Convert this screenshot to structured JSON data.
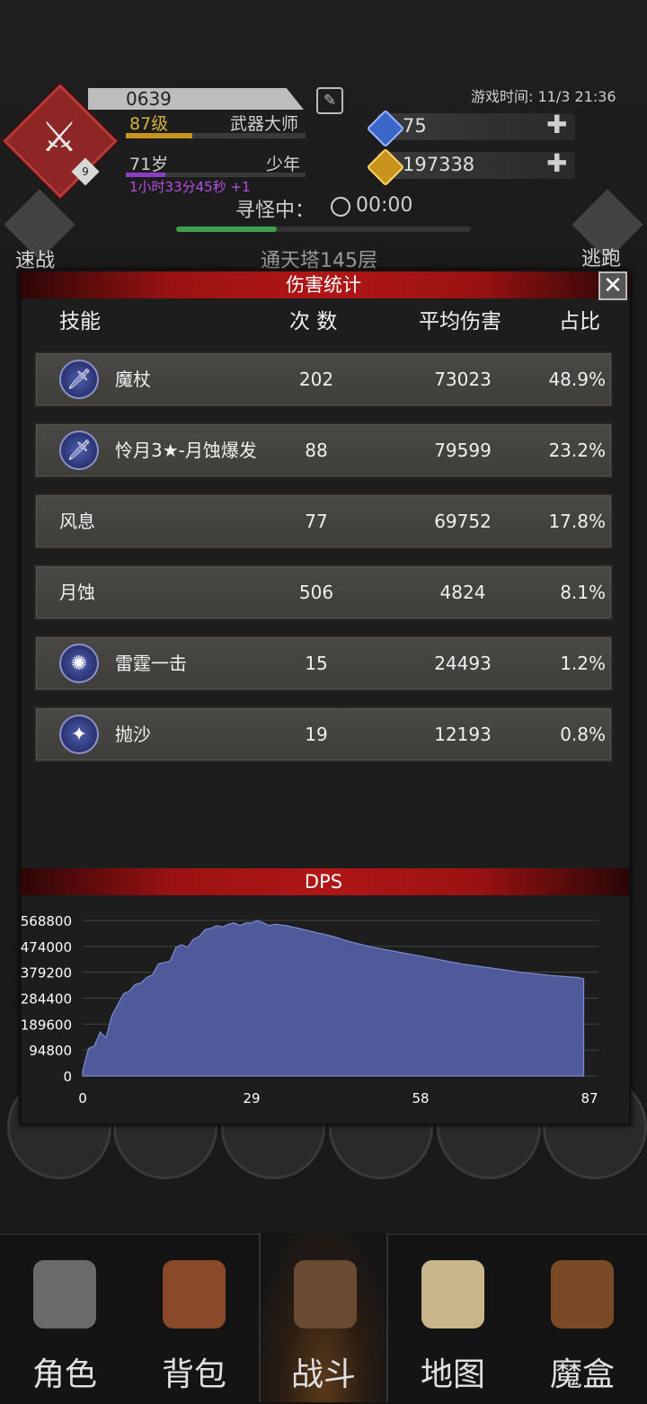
{
  "header": {
    "player_id": "0639",
    "level": "87级",
    "class_title": "武器大师",
    "level_badge": "9",
    "xp_progress": 0.37,
    "age": "71岁",
    "life_stage": "少年",
    "age_progress": 0.22,
    "timer": "1小时33分45秒 +1",
    "game_time": "游戏时间: 11/3 21:36",
    "gems": "75",
    "gold": "197338",
    "status": "寻怪中：",
    "clock": "00:00",
    "search_progress": 0.34,
    "quick_battle": "速战",
    "flee": "逃跑",
    "tower": "通天塔145层"
  },
  "panel": {
    "title": "伤害统计",
    "close": "✕",
    "columns": {
      "skill": "技能",
      "count": "次 数",
      "avg": "平均伤害",
      "share": "占比"
    },
    "rows": [
      {
        "name": "魔杖",
        "count": "202",
        "avg": "73023",
        "share": "48.9%",
        "icon": "sword-icon"
      },
      {
        "name": "怜月3★-月蚀爆发",
        "count": "88",
        "avg": "79599",
        "share": "23.2%",
        "icon": "sword-icon"
      },
      {
        "name": "风息",
        "count": "77",
        "avg": "69752",
        "share": "17.8%",
        "icon": ""
      },
      {
        "name": "月蚀",
        "count": "506",
        "avg": "4824",
        "share": "8.1%",
        "icon": ""
      },
      {
        "name": "雷霆一击",
        "count": "15",
        "avg": "24493",
        "share": "1.2%",
        "icon": "thunder-icon"
      },
      {
        "name": "抛沙",
        "count": "19",
        "avg": "12193",
        "share": "0.8%",
        "icon": "sand-icon"
      }
    ],
    "dps_title": "DPS"
  },
  "chart_data": {
    "type": "area",
    "title": "DPS",
    "xlabel": "",
    "ylabel": "",
    "xlim": [
      0,
      87
    ],
    "ylim": [
      0,
      568800
    ],
    "x_ticks": [
      "0",
      "29",
      "58",
      "87"
    ],
    "y_ticks": [
      "568800",
      "474000",
      "379200",
      "284400",
      "189600",
      "94800",
      "0"
    ],
    "grid": true,
    "color": "#4f5a9a",
    "series": [
      {
        "x": [
          0,
          1,
          2,
          3,
          4,
          5,
          6,
          7,
          8,
          9,
          10,
          11,
          12,
          13,
          14,
          15,
          16,
          17,
          18,
          19,
          20,
          21,
          22,
          23,
          24,
          25,
          26,
          27,
          28,
          29,
          30,
          31,
          32,
          33,
          35,
          37,
          40,
          43,
          46,
          50,
          55,
          60,
          65,
          70,
          75,
          80,
          85,
          86
        ],
        "y": [
          20000,
          100000,
          110000,
          160000,
          140000,
          220000,
          260000,
          300000,
          310000,
          335000,
          340000,
          360000,
          370000,
          410000,
          415000,
          420000,
          470000,
          480000,
          470000,
          500000,
          510000,
          535000,
          540000,
          550000,
          545000,
          555000,
          560000,
          550000,
          560000,
          560000,
          568000,
          560000,
          550000,
          555000,
          550000,
          540000,
          525000,
          510000,
          490000,
          470000,
          450000,
          430000,
          410000,
          395000,
          380000,
          368000,
          360000,
          355000
        ]
      }
    ]
  },
  "nav": {
    "items": [
      {
        "label": "角色"
      },
      {
        "label": "背包"
      },
      {
        "label": "战斗"
      },
      {
        "label": "地图"
      },
      {
        "label": "魔盒"
      }
    ]
  }
}
